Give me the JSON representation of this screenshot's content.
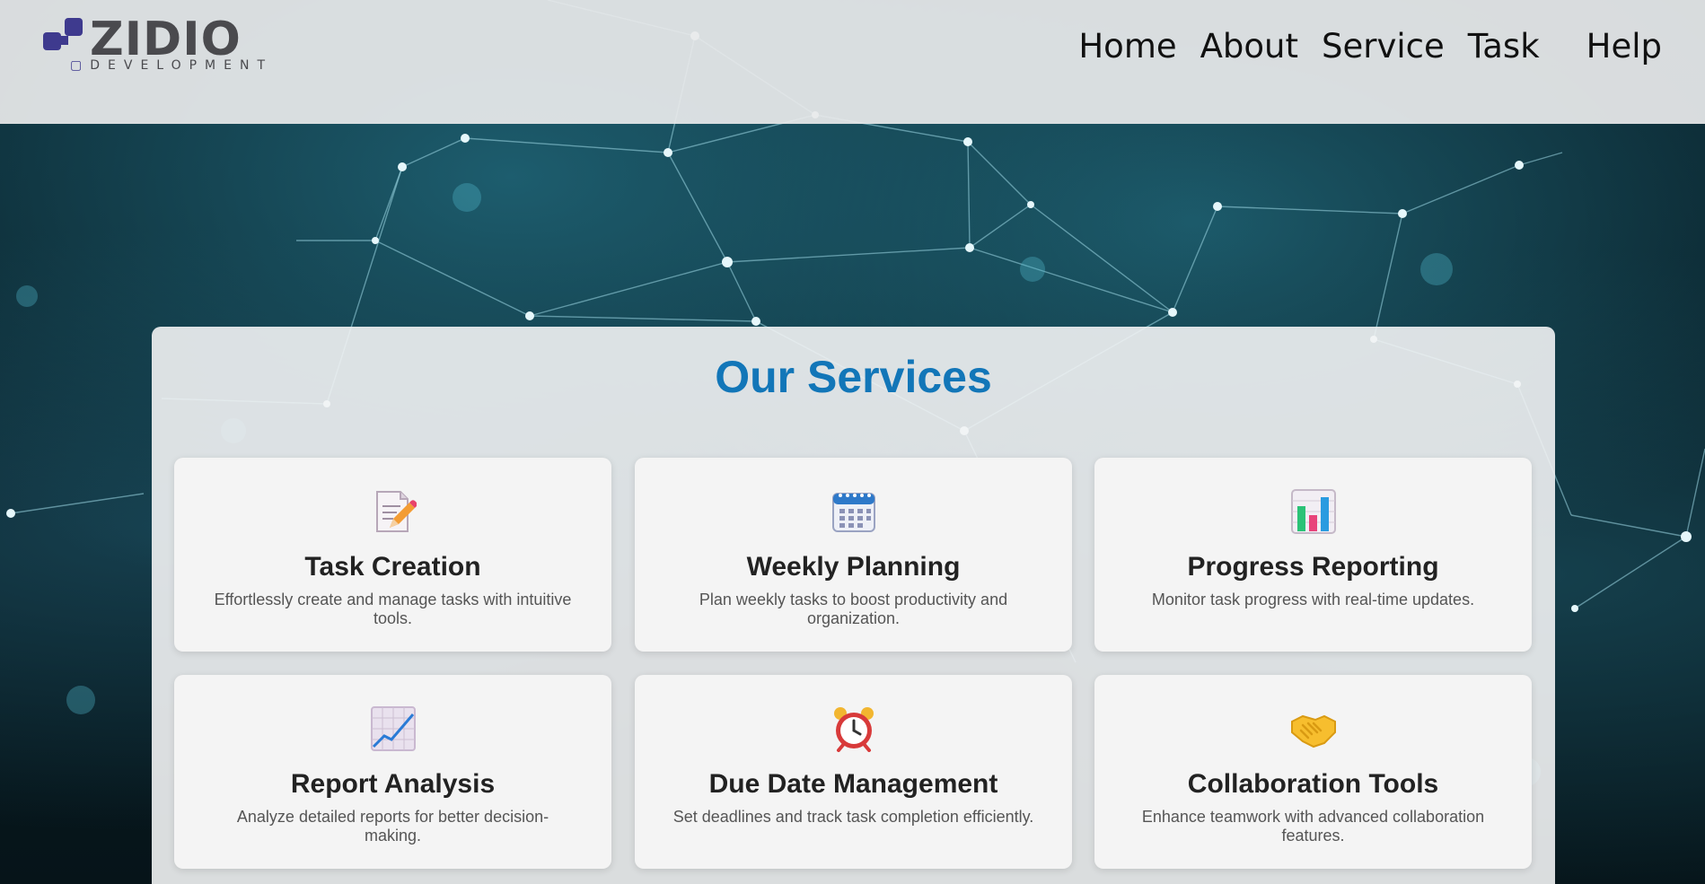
{
  "brand": {
    "name": "ZIDIO",
    "tagline": "DEVELOPMENT"
  },
  "nav": {
    "items": [
      "Home",
      "About",
      "Service",
      "Task",
      "Help"
    ]
  },
  "services": {
    "title": "Our Services",
    "cards": [
      {
        "icon": "memo-pencil-icon",
        "title": "Task Creation",
        "desc": "Effortlessly create and manage tasks with intuitive tools."
      },
      {
        "icon": "calendar-icon",
        "title": "Weekly Planning",
        "desc": "Plan weekly tasks to boost productivity and organization."
      },
      {
        "icon": "bar-chart-icon",
        "title": "Progress Reporting",
        "desc": "Monitor task progress with real-time updates."
      },
      {
        "icon": "chart-increasing-icon",
        "title": "Report Analysis",
        "desc": "Analyze detailed reports for better decision-making."
      },
      {
        "icon": "alarm-clock-icon",
        "title": "Due Date Management",
        "desc": "Set deadlines and track task completion efficiently."
      },
      {
        "icon": "handshake-icon",
        "title": "Collaboration Tools",
        "desc": "Enhance teamwork with advanced collaboration features."
      }
    ]
  },
  "colors": {
    "title_blue": "#1276b8",
    "logo_purple": "#3e3a8e",
    "logo_gray": "#4a4a4e"
  }
}
